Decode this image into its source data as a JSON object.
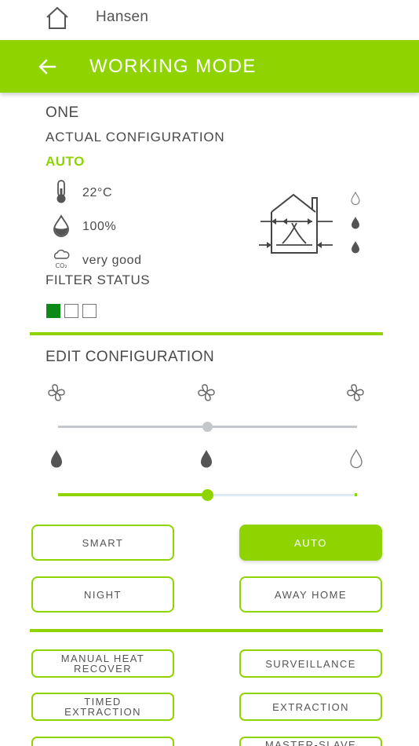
{
  "topbar": {
    "user_name": "Hansen"
  },
  "header": {
    "title": "WORKING MODE"
  },
  "unit": {
    "name": "ONE",
    "actual_configuration_label": "ACTUAL CONFIGURATION",
    "mode": "AUTO",
    "temperature": "22°C",
    "humidity": "100%",
    "air_quality": "very good",
    "filter_status_label": "FILTER STATUS",
    "filter_levels_filled": 1,
    "filter_levels_total": 3,
    "co2_icon_text": "CO₂"
  },
  "edit": {
    "title": "EDIT CONFIGURATION",
    "fan_speed_level": 0.5,
    "humidity_level": 0.5
  },
  "modes": {
    "smart": "SMART",
    "auto": "AUTO",
    "night": "NIGHT",
    "away_home": "AWAY HOME",
    "selected": "AUTO"
  },
  "functions": {
    "manual_heat_recover": "MANUAL HEAT\nRECOVER",
    "surveillance": "SURVEILLANCE",
    "timed_extraction": "TIMED\nEXTRACTION",
    "extraction": "EXTRACTION",
    "master_slave": "MASTER-SLAVE"
  },
  "colors": {
    "accent": "#8fd400",
    "filter_on": "#0b8a16",
    "text": "#4a4a4a",
    "slider_grey": "#c4c8cc"
  }
}
